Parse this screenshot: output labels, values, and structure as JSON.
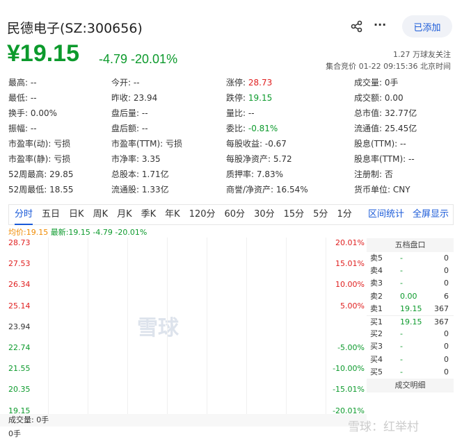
{
  "header": {
    "title": "民德电子(SZ:300656)",
    "price": "¥19.15",
    "change": "-4.79 -20.01%",
    "followers": "1.27 万球友关注",
    "time": "集合竞价 01-22 09:15:36 北京时间",
    "added_label": "已添加",
    "more_label": "···"
  },
  "stats": [
    [
      {
        "l": "最高:",
        "v": "--"
      },
      {
        "l": "今开:",
        "v": "--"
      },
      {
        "l": "涨停:",
        "v": "28.73",
        "c": "red"
      },
      {
        "l": "成交量:",
        "v": "0手"
      }
    ],
    [
      {
        "l": "最低:",
        "v": "--"
      },
      {
        "l": "昨收:",
        "v": "23.94"
      },
      {
        "l": "跌停:",
        "v": "19.15",
        "c": "green"
      },
      {
        "l": "成交额:",
        "v": "0.00"
      }
    ],
    [
      {
        "l": "换手:",
        "v": "0.00%"
      },
      {
        "l": "盘后量:",
        "v": "--"
      },
      {
        "l": "量比:",
        "v": "--"
      },
      {
        "l": "总市值:",
        "v": "32.77亿"
      }
    ],
    [
      {
        "l": "振幅:",
        "v": "--"
      },
      {
        "l": "盘后额:",
        "v": "--"
      },
      {
        "l": "委比:",
        "v": "-0.81%",
        "c": "green"
      },
      {
        "l": "流通值:",
        "v": "25.45亿"
      }
    ],
    [
      {
        "l": "市盈率(动):",
        "v": "亏损"
      },
      {
        "l": "市盈率(TTM):",
        "v": "亏损"
      },
      {
        "l": "每股收益:",
        "v": "-0.67"
      },
      {
        "l": "股息(TTM):",
        "v": "--"
      }
    ],
    [
      {
        "l": "市盈率(静):",
        "v": "亏损"
      },
      {
        "l": "市净率:",
        "v": "3.35"
      },
      {
        "l": "每股净资产:",
        "v": "5.72"
      },
      {
        "l": "股息率(TTM):",
        "v": "--"
      }
    ],
    [
      {
        "l": "52周最高:",
        "v": "29.85"
      },
      {
        "l": "总股本:",
        "v": "1.71亿"
      },
      {
        "l": "质押率:",
        "v": "7.83%"
      },
      {
        "l": "注册制:",
        "v": "否"
      }
    ],
    [
      {
        "l": "52周最低:",
        "v": "18.55"
      },
      {
        "l": "流通股:",
        "v": "1.33亿"
      },
      {
        "l": "商誉/净资产:",
        "v": "16.54%"
      },
      {
        "l": "货币单位:",
        "v": "CNY"
      }
    ]
  ],
  "tabs": [
    "分时",
    "五日",
    "日K",
    "周K",
    "月K",
    "季K",
    "年K",
    "120分",
    "60分",
    "30分",
    "15分",
    "5分",
    "1分"
  ],
  "tab_right": [
    "区间统计",
    "全屏显示"
  ],
  "legend": {
    "avg": "均价:19.15",
    "latest": "最新:19.15 -4.79 -20.01%"
  },
  "chart": {
    "prices": [
      "28.73",
      "27.53",
      "26.34",
      "25.14",
      "23.94",
      "22.74",
      "21.55",
      "20.35",
      "19.15"
    ],
    "pcts": [
      "20.01%",
      "15.01%",
      "10.00%",
      "5.00%",
      "",
      "-5.00%",
      "-10.00%",
      "-15.01%",
      "-20.01%"
    ],
    "watermark": "雪球"
  },
  "book": {
    "title": "五档盘口",
    "footer": "成交明细",
    "rows": [
      [
        "卖5",
        "-",
        "0"
      ],
      [
        "卖4",
        "-",
        "0"
      ],
      [
        "卖3",
        "-",
        "0"
      ],
      [
        "卖2",
        "0.00",
        "6"
      ],
      [
        "卖1",
        "19.15",
        "367"
      ],
      [
        "买1",
        "19.15",
        "367"
      ],
      [
        "买2",
        "-",
        "0"
      ],
      [
        "买3",
        "-",
        "0"
      ],
      [
        "买4",
        "-",
        "0"
      ],
      [
        "买5",
        "-",
        "0"
      ]
    ]
  },
  "volume": {
    "label": "成交量: 0手",
    "value": "0手"
  },
  "watermark": "雪球：红举村",
  "colors": {
    "up": "#e02020",
    "down": "#0c9a2c",
    "accent": "#1a5ad8"
  }
}
